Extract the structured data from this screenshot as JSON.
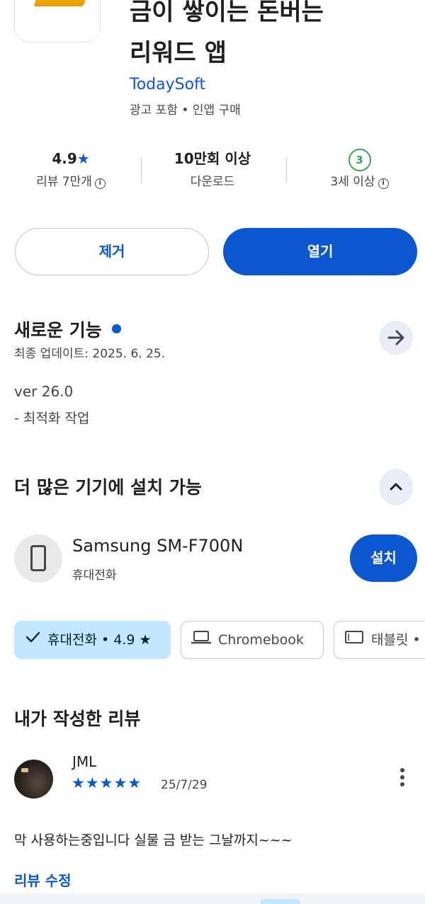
{
  "app": {
    "title_line1": "금이 쌓이는 돈버는",
    "title_line2": "리워드 앱",
    "developer": "TodaySoft",
    "meta": "광고 포함 • 인앱 구매"
  },
  "stats": {
    "rating_value": "4.9",
    "rating_star": "★",
    "rating_label": "리뷰 7만개",
    "downloads_value": "10만회 이상",
    "downloads_label": "다운로드",
    "age_badge": "3",
    "age_label": "3세 이상",
    "info_glyph": "i"
  },
  "actions": {
    "remove_label": "제거",
    "open_label": "열기"
  },
  "whats_new": {
    "title": "새로운 기능",
    "updated": "최종 업데이트: 2025. 6. 25.",
    "version": "ver 26.0",
    "note": "- 최적화 작업"
  },
  "devices": {
    "title": "더 많은 기기에 설치 가능",
    "device_name": "Samsung SM-F700N",
    "device_type": "휴대전화",
    "install_label": "설치",
    "chips": [
      {
        "label": "휴대전화 • 4.9 ★",
        "selected": true
      },
      {
        "label": "Chromebook",
        "selected": false
      },
      {
        "label": "태블릿 • 4",
        "selected": false
      }
    ]
  },
  "my_review": {
    "title": "내가 작성한 리뷰",
    "reviewer": "JML",
    "stars": "★★★★★",
    "rating": 5,
    "date": "25/7/29",
    "text": "막 사용하는중입니다 실물 금 받는 그날까지~~~",
    "edit_label": "리뷰 수정"
  },
  "colors": {
    "accent": "#0b57d0",
    "chip_selected": "#c2e7ff",
    "age_badge": "#34a853"
  },
  "icons": [
    "app-icon",
    "info-icon",
    "arrow-right-icon",
    "chevron-up-icon",
    "phone-icon",
    "check-icon",
    "laptop-icon",
    "tablet-icon",
    "more-vert-icon"
  ]
}
